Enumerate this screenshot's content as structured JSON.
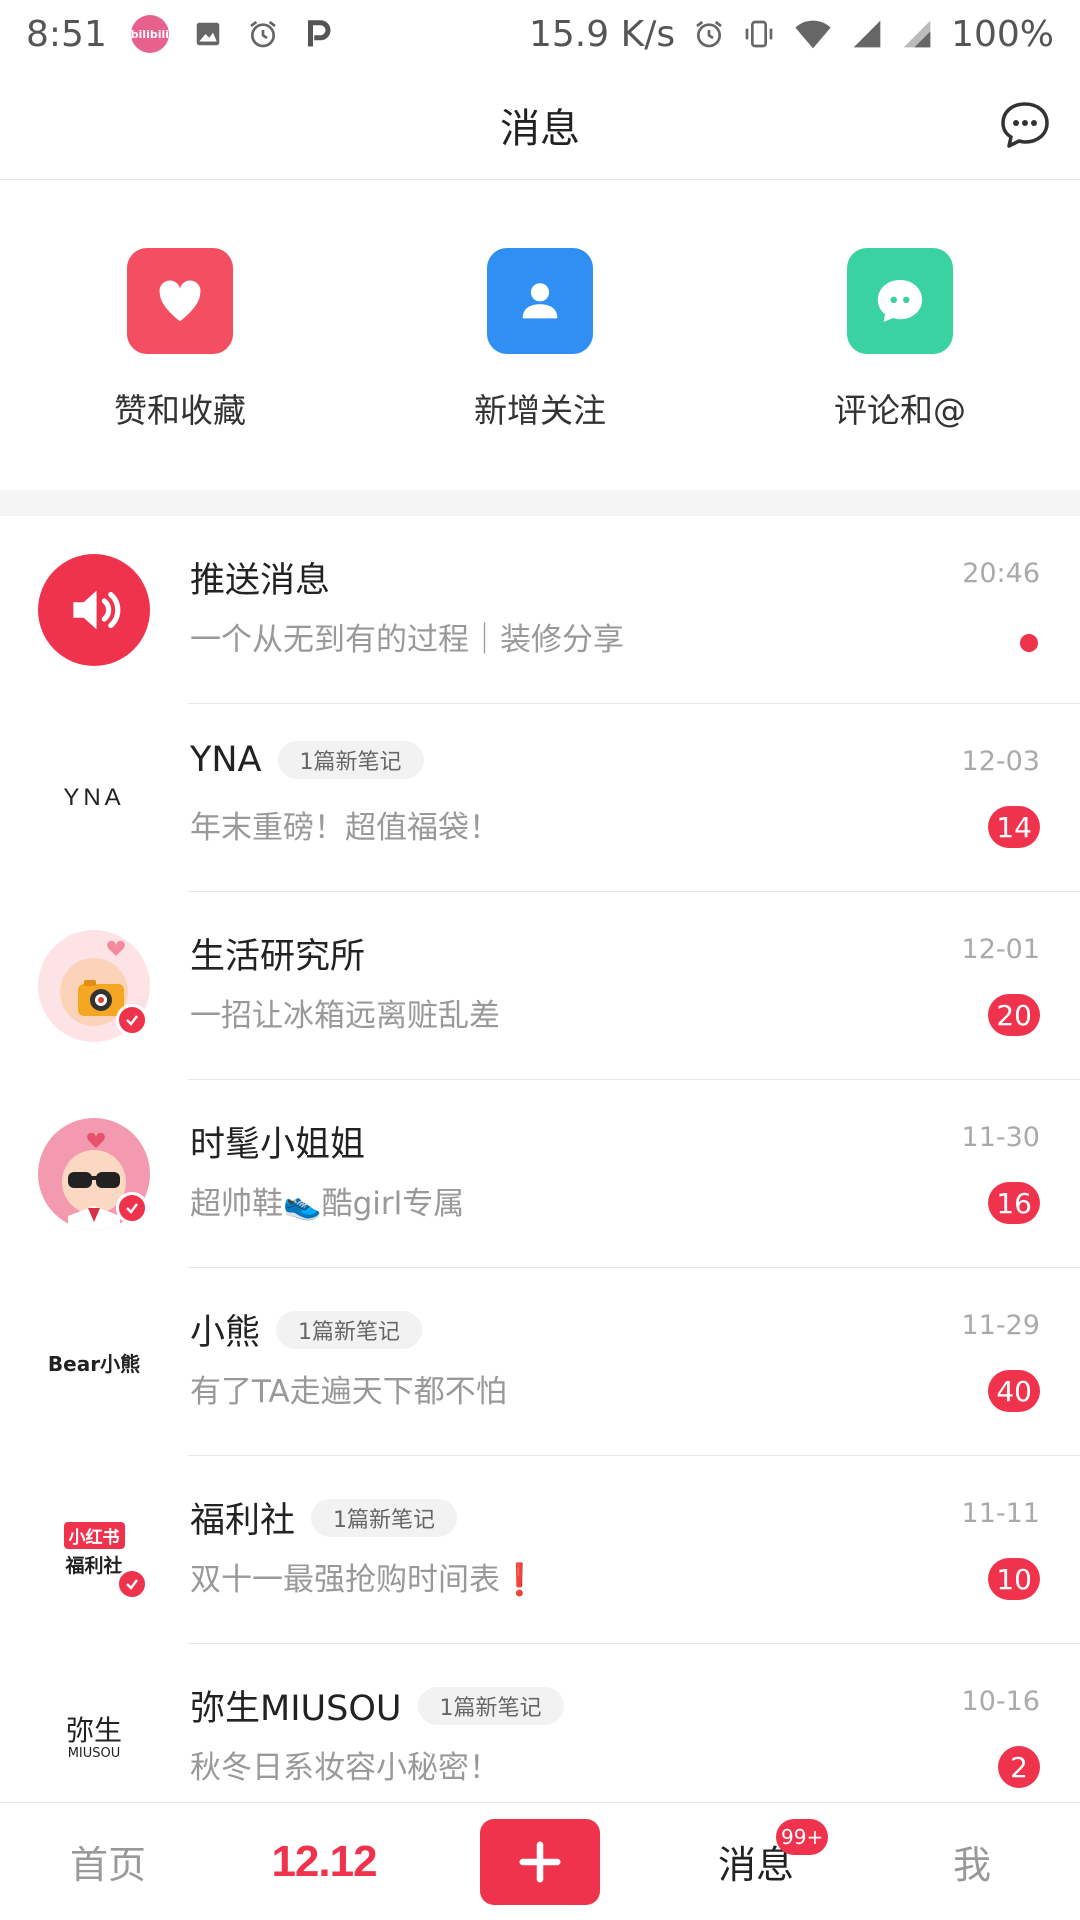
{
  "status_bar": {
    "time": "8:51",
    "network_speed": "15.9 K/s",
    "battery": "100%",
    "app_badge_text": "bilibili",
    "icons": [
      "bilibili-icon",
      "image-icon",
      "alarm-icon",
      "p-icon",
      "alarm-icon",
      "vibrate-icon",
      "wifi-icon",
      "signal-icon",
      "signal-icon"
    ]
  },
  "header": {
    "title": "消息",
    "right_icon": "chat-bubble-icon"
  },
  "quick_actions": [
    {
      "label": "赞和收藏",
      "icon": "heart-icon",
      "color": "#f44e63"
    },
    {
      "label": "新增关注",
      "icon": "user-icon",
      "color": "#2f8ff2"
    },
    {
      "label": "评论和@",
      "icon": "comment-icon",
      "color": "#3ad2a0"
    }
  ],
  "messages": [
    {
      "name": "推送消息",
      "preview": "一个从无到有的过程｜装修分享",
      "time": "20:46",
      "dot": true,
      "avatar": "megaphone-icon"
    },
    {
      "name": "YNA",
      "tag": "1篇新笔记",
      "preview": "年末重磅！超值福袋！",
      "time": "12-03",
      "badge": "14",
      "avatar_text": "YNA"
    },
    {
      "name": "生活研究所",
      "preview": "一招让冰箱远离赃乱差",
      "time": "12-01",
      "badge": "20",
      "avatar": "camera-cartoon-icon",
      "verified": true
    },
    {
      "name": "时髦小姐姐",
      "preview": "超帅鞋👟酷girl专属",
      "time": "11-30",
      "badge": "16",
      "avatar": "sunglasses-cartoon-icon",
      "verified": true
    },
    {
      "name": "小熊",
      "tag": "1篇新笔记",
      "preview": "有了TA走遍天下都不怕",
      "time": "11-29",
      "badge": "40",
      "avatar_text": "Bear小熊"
    },
    {
      "name": "福利社",
      "tag": "1篇新笔记",
      "preview": "双十一最强抢购时间表❗",
      "time": "11-11",
      "badge": "10",
      "avatar_text": "小红书",
      "avatar_text2": "福利社",
      "verified": true
    },
    {
      "name": "弥生MIUSOU",
      "tag": "1篇新笔记",
      "preview": "秋冬日系妆容小秘密！",
      "time": "10-16",
      "badge": "2",
      "avatar_text": "弥生",
      "avatar_text2": "MIUSOU"
    }
  ],
  "bottom_nav": {
    "items": [
      "首页",
      "12.12",
      "+",
      "消息",
      "我"
    ],
    "message_badge": "99+",
    "active": "消息"
  }
}
